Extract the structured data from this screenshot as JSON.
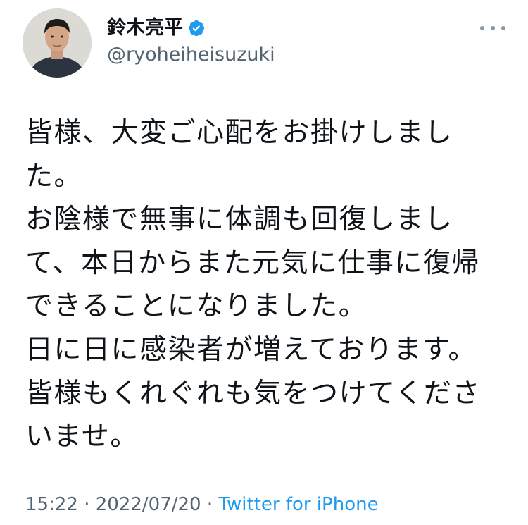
{
  "author": {
    "display_name": "鈴木亮平",
    "handle": "@ryoheiheisuzuki",
    "verified": true
  },
  "tweet": {
    "lines": [
      "皆様、大変ご心配をお掛けしまし",
      "た。",
      "お陰様で無事に体調も回復しまし",
      "て、本日からまた元気に仕事に復帰",
      "できることになりました。",
      "日に日に感染者が増えております。",
      "皆様もくれぐれも気をつけてくださ",
      "いませ。"
    ],
    "time": "15:22",
    "separator_1": "·",
    "date": "2022/07/20",
    "separator_2": "·",
    "source": "Twitter for iPhone"
  },
  "icons": {
    "verified": "verified-badge-icon",
    "more": "more-options-icon"
  },
  "colors": {
    "text": "#0f1419",
    "secondary": "#536471",
    "link": "#1d9bf0",
    "verified": "#1d9bf0"
  }
}
